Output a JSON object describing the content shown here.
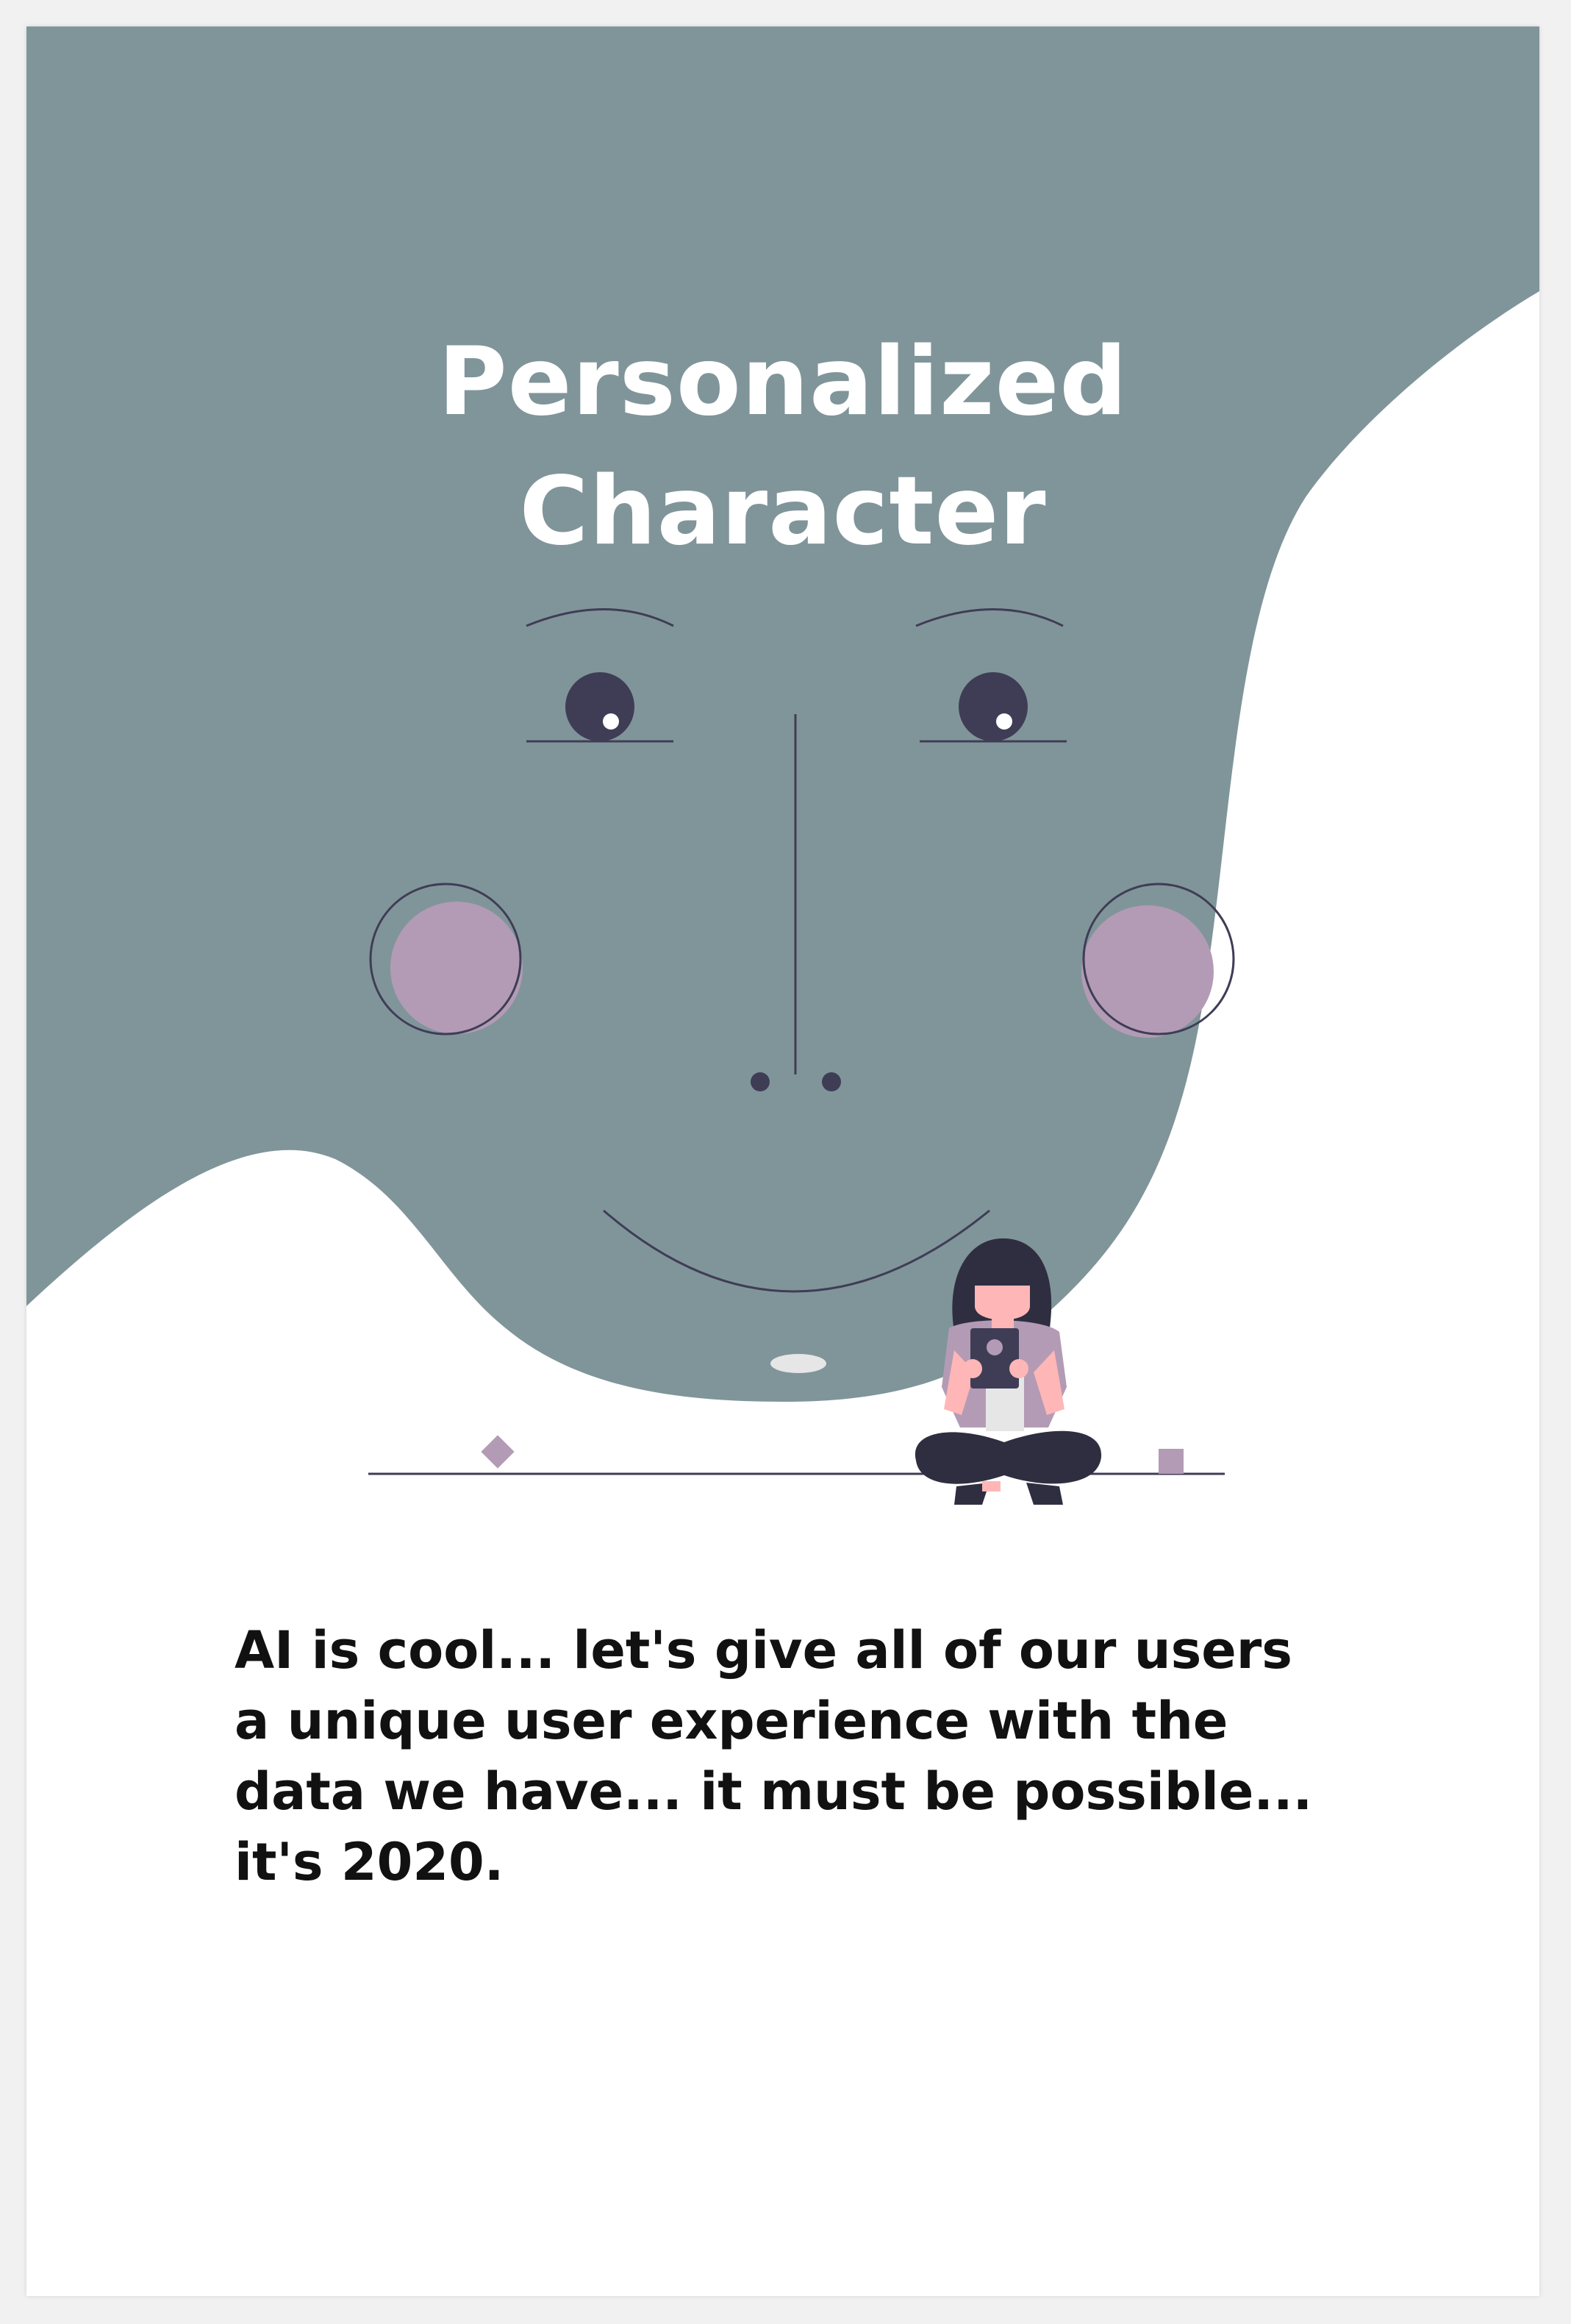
{
  "title": {
    "line1": "Personalized",
    "line2": "Character"
  },
  "body": {
    "text": "AI is cool... let's give all of our users a unique user experience with the data we have... it must be possible... it's 2020."
  },
  "colors": {
    "background_blob": "#80959a",
    "cheek": "#b39bb5",
    "line": "#3f3d56",
    "pupil": "#3f3d56",
    "accent": "#b39bb5",
    "text": "#111111",
    "title": "#ffffff"
  },
  "illustration": {
    "icons": [
      "face-illustration",
      "person-with-tablet-icon",
      "diamond-shape-icon",
      "square-shape-icon"
    ]
  }
}
